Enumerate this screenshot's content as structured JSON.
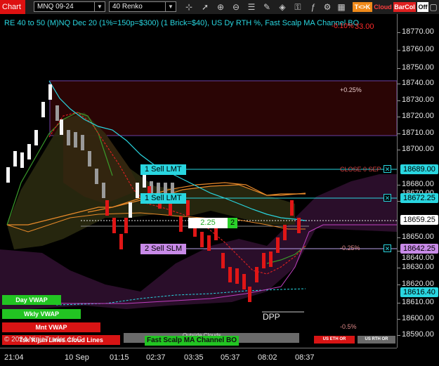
{
  "toolbar": {
    "chart_tab": "Chart",
    "instrument": "MNQ 09-24",
    "bar_type": "40 Renko",
    "icons": [
      "crosshair-icon",
      "zoom-in-icon",
      "zoom-out-icon",
      "properties-icon",
      "drawing-icon",
      "shapes-icon",
      "lock-icon",
      "indicator-icon",
      "strategy-icon",
      "template-icon"
    ],
    "tk_label": "T<>K",
    "cloud_label": "Cloud",
    "barcol_label": "BarCol",
    "off_label": "Off"
  },
  "chart": {
    "header": "RE 40 to 50 (M)NQ Dec 20 (1%=150p=$300) (1 Brick=$40), US Dy RTH %, Fast Scalp MA Channel BO",
    "header_right": "33.00",
    "header_pct": "-0.10%",
    "pct_plus": "+0.25%",
    "pct_minus": "-0.25%",
    "pct_minus2": "-0.5%",
    "close_label": "CLOSE 0 SEP",
    "dpp": "DPP",
    "copyright": "© 2024 NinjaTrader, LLC",
    "fast_scalp_overlay": "Fast Scalp MA Channel BO",
    "outside_clouds": "Outside Clouds",
    "vwaps": [
      "Day VWAP",
      "Wkly VWAP",
      "Mnt VWAP",
      "Tsk Kijun Lines Cloud Lines"
    ],
    "us_eth": "US ETH OR",
    "us_rth": "US RTH OR"
  },
  "orders": {
    "sell_lmt_1": "1 Sell LMT",
    "sell_lmt_2": "1 Sell LMT",
    "sell_slm": "2 Sell SLM",
    "position_pnl": "2.25",
    "position_qty": "2"
  },
  "price_axis": {
    "ticks": [
      "18770.00",
      "18760.00",
      "18750.00",
      "18740.00",
      "18730.00",
      "18720.00",
      "18710.00",
      "18700.00",
      "18680.00",
      "18670.00",
      "18650.00",
      "18640.00",
      "18630.00",
      "18620.00",
      "18610.00",
      "18600.00",
      "18590.00"
    ],
    "markers": {
      "sell_lmt_1": "18689.00",
      "sell_lmt_2": "18672.25",
      "last": "18659.25",
      "sell_slm": "18642.25",
      "vwap": "18616.40"
    }
  },
  "time_axis": {
    "ticks": [
      "21:04",
      "10 Sep",
      "01:15",
      "02:37",
      "03:35",
      "05:37",
      "08:02",
      "08:37"
    ]
  }
}
